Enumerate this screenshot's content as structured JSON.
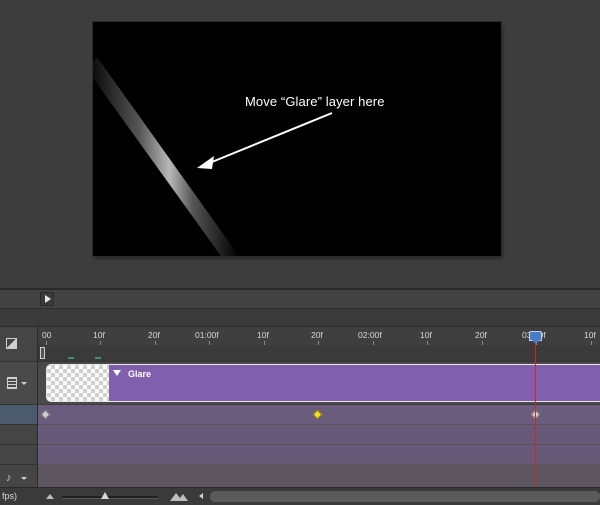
{
  "canvas": {
    "annotation": "Move “Glare” layer here"
  },
  "timeline": {
    "ruler_labels": [
      "00",
      "10f",
      "20f",
      "01:00f",
      "10f",
      "20f",
      "02:00f",
      "10f",
      "20f",
      "03:00f",
      "10f"
    ],
    "layer": {
      "name": "Glare"
    },
    "keyframes": [
      {
        "color": "grey",
        "label": "start"
      },
      {
        "color": "yellow",
        "label": "selected"
      },
      {
        "color": "grey",
        "label": "end"
      }
    ],
    "frame_rate_label": "fps)"
  },
  "colors": {
    "clip": "#7f5fae",
    "playhead": "#d0262a",
    "keyframe_selected": "#f2df2c",
    "keyframe_default": "#cfcfcf"
  }
}
